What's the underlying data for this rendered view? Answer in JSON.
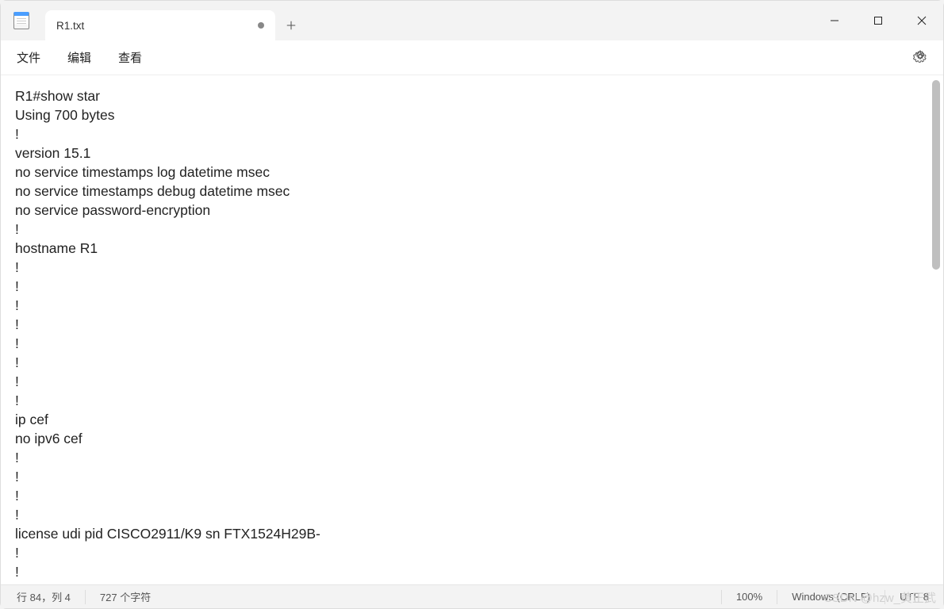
{
  "tab": {
    "title": "R1.txt"
  },
  "menu": {
    "file": "文件",
    "edit": "编辑",
    "view": "查看"
  },
  "content": "R1#show star\nUsing 700 bytes\n!\nversion 15.1\nno service timestamps log datetime msec\nno service timestamps debug datetime msec\nno service password-encryption\n!\nhostname R1\n!\n!\n!\n!\n!\n!\n!\n!\nip cef\nno ipv6 cef\n!\n!\n!\n!\nlicense udi pid CISCO2911/K9 sn FTX1524H29B-\n!\n!",
  "status": {
    "position": "行 84，列 4",
    "chars": "727 个字符",
    "zoom": "100%",
    "line_ending": "Windows (CRLF)",
    "encoding": "UTF-8"
  },
  "watermark": "CSDN @hzw_黄正武"
}
